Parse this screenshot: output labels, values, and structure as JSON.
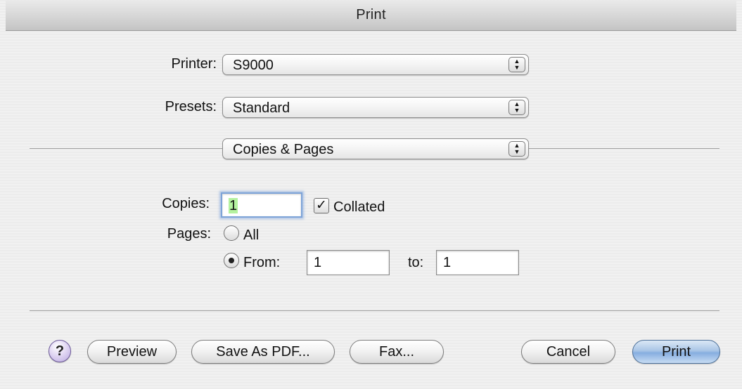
{
  "window": {
    "title": "Print"
  },
  "printer": {
    "label": "Printer:",
    "value": "S9000"
  },
  "presets": {
    "label": "Presets:",
    "value": "Standard"
  },
  "panel": {
    "value": "Copies & Pages"
  },
  "copies": {
    "label": "Copies:",
    "value": "1",
    "collated_label": "Collated",
    "collated_checked": true
  },
  "pages": {
    "label": "Pages:",
    "all_label": "All",
    "from_label": "From:",
    "from_value": "1",
    "to_label": "to:",
    "to_value": "1",
    "selected": "from"
  },
  "icons": {
    "popup_arrows": "up-down-arrows-icon",
    "help": "help-icon",
    "check": "checkmark-icon"
  },
  "buttons": {
    "help": "?",
    "preview": "Preview",
    "save_pdf": "Save As PDF...",
    "fax": "Fax...",
    "cancel": "Cancel",
    "print": "Print"
  },
  "colors": {
    "default_button": "#86aee0",
    "focus_ring": "#7ea4d8",
    "selection": "#b5f2a0"
  }
}
